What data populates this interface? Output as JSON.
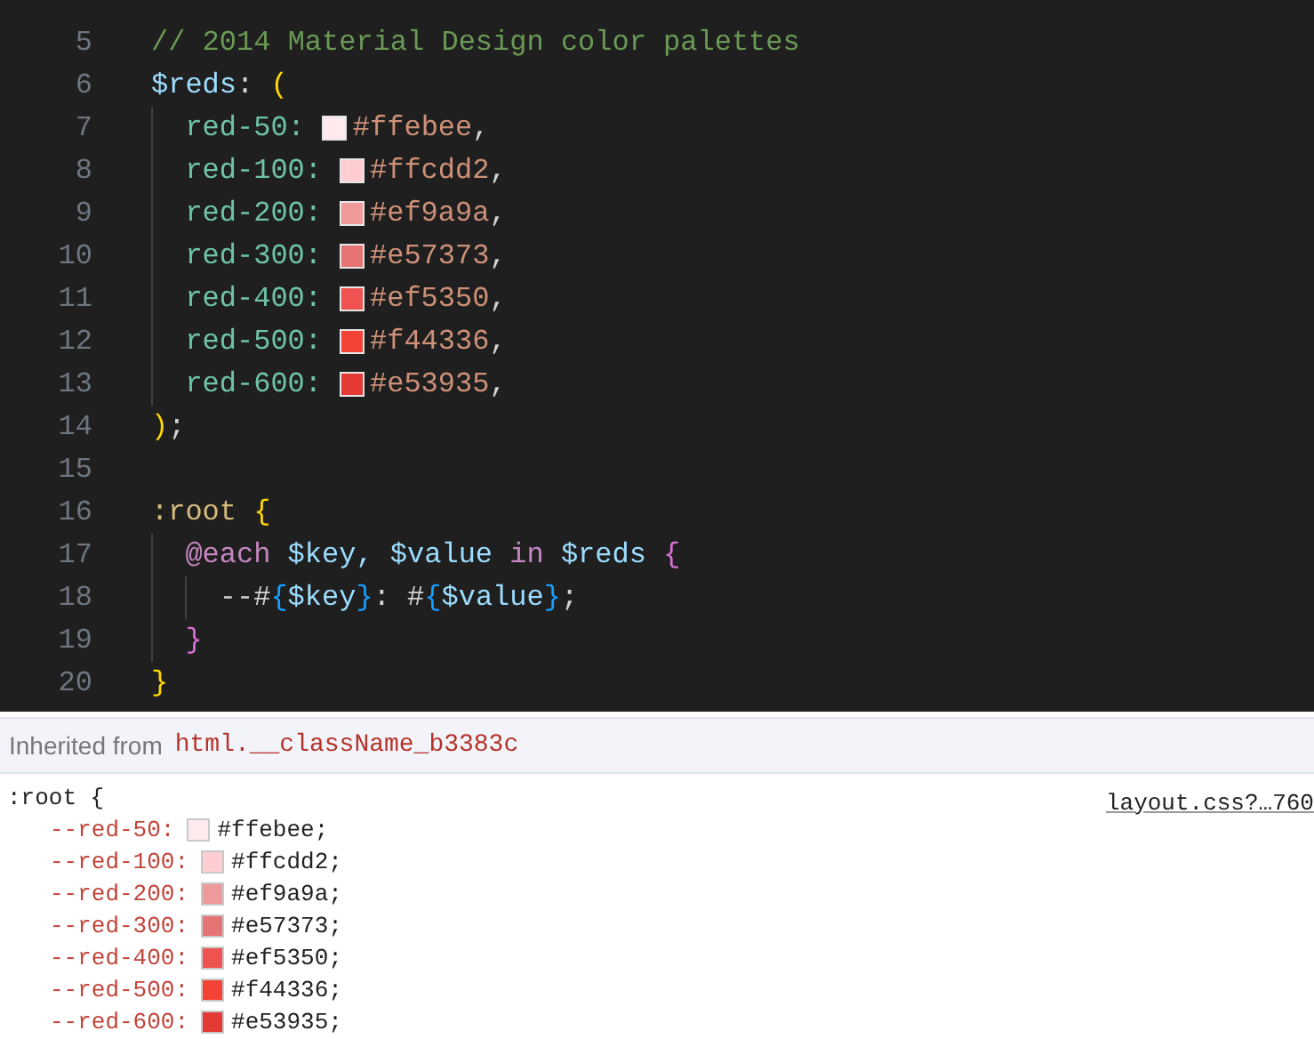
{
  "editor": {
    "lines": [
      {
        "number": "5",
        "tokens": [
          {
            "kind": "comment",
            "text": "// 2014 Material Design color palettes"
          }
        ]
      },
      {
        "number": "6",
        "tokens": [
          {
            "kind": "variable",
            "text": "$reds"
          },
          {
            "kind": "punct",
            "text": ": "
          },
          {
            "kind": "paren",
            "text": "("
          }
        ]
      },
      {
        "number": "7",
        "tokens": [
          {
            "kind": "guide"
          },
          {
            "kind": "key",
            "text": "red-50:"
          },
          {
            "kind": "swatch",
            "color": "#ffebee"
          },
          {
            "kind": "value",
            "text": "#ffebee"
          },
          {
            "kind": "punct",
            "text": ","
          }
        ]
      },
      {
        "number": "8",
        "tokens": [
          {
            "kind": "guide"
          },
          {
            "kind": "key",
            "text": "red-100:"
          },
          {
            "kind": "swatch",
            "color": "#ffcdd2"
          },
          {
            "kind": "value",
            "text": "#ffcdd2"
          },
          {
            "kind": "punct",
            "text": ","
          }
        ]
      },
      {
        "number": "9",
        "tokens": [
          {
            "kind": "guide"
          },
          {
            "kind": "key",
            "text": "red-200:"
          },
          {
            "kind": "swatch",
            "color": "#ef9a9a"
          },
          {
            "kind": "value",
            "text": "#ef9a9a"
          },
          {
            "kind": "punct",
            "text": ","
          }
        ]
      },
      {
        "number": "10",
        "tokens": [
          {
            "kind": "guide"
          },
          {
            "kind": "key",
            "text": "red-300:"
          },
          {
            "kind": "swatch",
            "color": "#e57373"
          },
          {
            "kind": "value",
            "text": "#e57373"
          },
          {
            "kind": "punct",
            "text": ","
          }
        ]
      },
      {
        "number": "11",
        "tokens": [
          {
            "kind": "guide"
          },
          {
            "kind": "key",
            "text": "red-400:"
          },
          {
            "kind": "swatch",
            "color": "#ef5350"
          },
          {
            "kind": "value",
            "text": "#ef5350"
          },
          {
            "kind": "punct",
            "text": ","
          }
        ]
      },
      {
        "number": "12",
        "tokens": [
          {
            "kind": "guide"
          },
          {
            "kind": "key",
            "text": "red-500:"
          },
          {
            "kind": "swatch",
            "color": "#f44336"
          },
          {
            "kind": "value",
            "text": "#f44336"
          },
          {
            "kind": "punct",
            "text": ","
          }
        ]
      },
      {
        "number": "13",
        "tokens": [
          {
            "kind": "guide"
          },
          {
            "kind": "key",
            "text": "red-600:"
          },
          {
            "kind": "swatch",
            "color": "#e53935"
          },
          {
            "kind": "value",
            "text": "#e53935"
          },
          {
            "kind": "punct",
            "text": ","
          }
        ]
      },
      {
        "number": "14",
        "tokens": [
          {
            "kind": "paren",
            "text": ")"
          },
          {
            "kind": "punct",
            "text": ";"
          }
        ]
      },
      {
        "number": "15"
      },
      {
        "number": "16",
        "tokens": [
          {
            "kind": "selector",
            "text": ":root"
          },
          {
            "kind": "paren",
            "text": " {"
          }
        ]
      },
      {
        "number": "17",
        "tokens": [
          {
            "kind": "guide"
          },
          {
            "kind": "atrule",
            "text": "@each"
          },
          {
            "kind": "variable",
            "text": " $key, $value"
          },
          {
            "kind": "keyword",
            "text": " in"
          },
          {
            "kind": "variable",
            "text": " $reds"
          },
          {
            "kind": "brace",
            "text": " {"
          }
        ]
      },
      {
        "number": "18",
        "tokens": [
          {
            "kind": "guide"
          },
          {
            "kind": "guide"
          },
          {
            "kind": "punct",
            "text": "--#"
          },
          {
            "kind": "interp",
            "text": "{"
          },
          {
            "kind": "variable",
            "text": "$key"
          },
          {
            "kind": "interp",
            "text": "}"
          },
          {
            "kind": "punct",
            "text": ": #"
          },
          {
            "kind": "interp",
            "text": "{"
          },
          {
            "kind": "variable",
            "text": "$value"
          },
          {
            "kind": "interp",
            "text": "}"
          },
          {
            "kind": "punct",
            "text": ";"
          }
        ]
      },
      {
        "number": "19",
        "tokens": [
          {
            "kind": "guide"
          },
          {
            "kind": "brace",
            "text": "}"
          }
        ]
      },
      {
        "number": "20",
        "tokens": [
          {
            "kind": "paren",
            "text": "}"
          }
        ]
      }
    ]
  },
  "styles_panel": {
    "inherited_label": "Inherited from",
    "inherited_selector": "html.__className_b3383c",
    "rule": {
      "selector": ":root {",
      "source_link": "layout.css?…760",
      "declarations": [
        {
          "name": "--red-50:",
          "color": "#ffebee",
          "value": "#ffebee;"
        },
        {
          "name": "--red-100:",
          "color": "#ffcdd2",
          "value": "#ffcdd2;"
        },
        {
          "name": "--red-200:",
          "color": "#ef9a9a",
          "value": "#ef9a9a;"
        },
        {
          "name": "--red-300:",
          "color": "#e57373",
          "value": "#e57373;"
        },
        {
          "name": "--red-400:",
          "color": "#ef5350",
          "value": "#ef5350;"
        },
        {
          "name": "--red-500:",
          "color": "#f44336",
          "value": "#f44336;"
        },
        {
          "name": "--red-600:",
          "color": "#e53935",
          "value": "#e53935;"
        }
      ]
    }
  }
}
